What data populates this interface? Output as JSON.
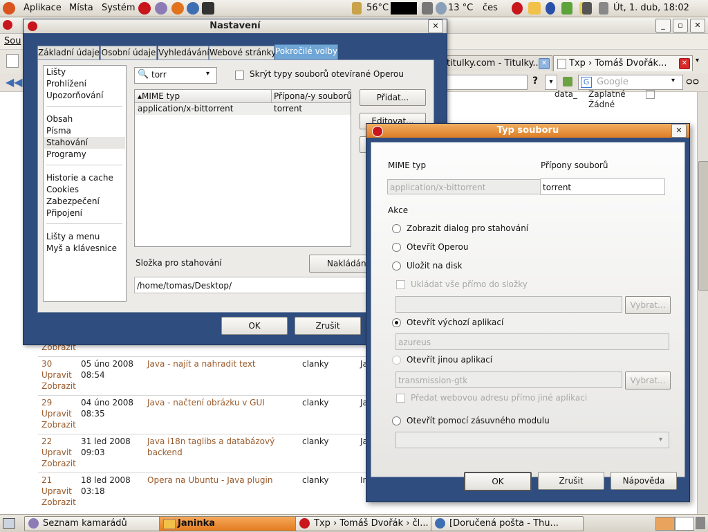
{
  "top_panel": {
    "menus": [
      "Aplikace",
      "Místa",
      "Systém"
    ],
    "cpu_temp": "56°C",
    "weather_temp": "13 °C",
    "keyboard": "čes",
    "clock": "Út,  1. dub, 18:02"
  },
  "opera": {
    "menu_first": "Sou",
    "tabs": [
      {
        "label": "titulky.com - Titulky..."
      },
      {
        "label": "Txp › Tomáš Dvořák..."
      }
    ],
    "search_placeholder": "Google",
    "page": {
      "partial_top": {
        "col1": "data_",
        "status_a": "Zaplatné",
        "status_b": "Žádné"
      },
      "first_link": "Zobrazit",
      "rows": [
        {
          "id": "30",
          "date": "05 úno 2008",
          "time": "08:54",
          "title": [
            "Java - najít a nahradit text"
          ],
          "section": "clanky",
          "author": "Ja"
        },
        {
          "id": "29",
          "date": "04 úno 2008",
          "time": "08:35",
          "title": [
            "Java - načtení obrázku v GUI"
          ],
          "section": "clanky",
          "author": "Ja"
        },
        {
          "id": "22",
          "date": "31 led 2008",
          "time": "09:03",
          "title": [
            "Java i18n taglibs a databázový",
            "backend"
          ],
          "section": "clanky",
          "author": "Ja"
        },
        {
          "id": "21",
          "date": "18 led 2008",
          "time": "03:18",
          "title": [
            "Opera na Ubuntu - Java plugin"
          ],
          "section": "clanky",
          "author": "In"
        }
      ],
      "row_links": [
        "Upravit",
        "Zobrazit"
      ]
    }
  },
  "nastaveni": {
    "title": "Nastavení",
    "tabs": [
      "Základní údaje",
      "Osobní údaje",
      "Vyhledávání",
      "Webové stránky",
      "Pokročilé volby"
    ],
    "categories": [
      [
        "Lišty",
        "Prohlížení",
        "Upozorňování"
      ],
      [
        "Obsah",
        "Písma",
        "Stahování",
        "Programy"
      ],
      [
        "Historie a cache",
        "Cookies",
        "Zabezpečení",
        "Připojení"
      ],
      [
        "Lišty a menu",
        "Myš a klávesnice"
      ]
    ],
    "search_value": "torr",
    "hide_types_label": "Skrýt typy souborů otevírané Operou",
    "columns": [
      "MIME typ",
      "Přípona/-y souborů"
    ],
    "rows": [
      {
        "mime": "application/x-bittorrent",
        "ext": "torrent"
      }
    ],
    "buttons": {
      "add": "Přidat...",
      "edit": "Editovat...",
      "ok": "OK",
      "cancel": "Zrušit",
      "download_btn": "Nakládání s"
    },
    "download_folder_label": "Složka pro stahování",
    "download_folder": "/home/tomas/Desktop/"
  },
  "typ_souboru": {
    "title": "Typ souboru",
    "mime_label": "MIME typ",
    "ext_label": "Přípony souborů",
    "mime_value": "application/x-bittorrent",
    "ext_value": "torrent",
    "actions_label": "Akce",
    "options": {
      "dialog": "Zobrazit dialog pro stahování",
      "open_opera": "Otevřít Operou",
      "save_disk": "Uložit na disk",
      "save_direct": "Ukládat vše přímo do složky",
      "open_default": "Otevřít výchozí aplikací",
      "default_app": "azureus",
      "open_other": "Otevřít jinou aplikací",
      "other_app": "transmission-gtk",
      "pass_url": "Předat webovou adresu přímo jiné aplikaci",
      "open_plugin": "Otevřít pomocí zásuvného modulu"
    },
    "browse": "Vybrat...",
    "buttons": {
      "ok": "OK",
      "cancel": "Zrušit",
      "help": "Nápověda"
    }
  },
  "taskbar": [
    {
      "label": "Seznam kamarádů"
    },
    {
      "label": "Janinka"
    },
    {
      "label": "Txp › Tomáš Dvořák › čl..."
    },
    {
      "label": "[Doručená pošta - Thu..."
    }
  ]
}
